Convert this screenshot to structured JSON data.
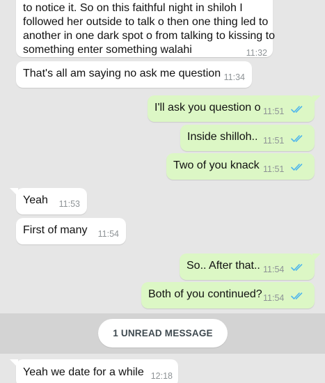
{
  "chat": {
    "messages": [
      {
        "direction": "in",
        "lines": [
          "to notice it. So on this faithful night in shiloh I",
          "followed her outside to talk o then one thing led to",
          "another in one dark spot o from talking to kissing to",
          "something enter something walahi"
        ],
        "time": "11:32"
      },
      {
        "direction": "in",
        "text": "That's all am saying no ask me question",
        "time": "11:34"
      },
      {
        "direction": "out",
        "text": "I'll ask you question o",
        "time": "11:51",
        "status": "read"
      },
      {
        "direction": "out",
        "text": "Inside shilloh..",
        "time": "11:51",
        "status": "read"
      },
      {
        "direction": "out",
        "text": "Two of you knack",
        "time": "11:51",
        "status": "read"
      },
      {
        "direction": "in",
        "text": "Yeah",
        "time": "11:53"
      },
      {
        "direction": "in",
        "text": "First of many",
        "time": "11:54"
      },
      {
        "direction": "out",
        "text": "So.. After that..",
        "time": "11:54",
        "status": "read"
      },
      {
        "direction": "out",
        "text": "Both of you continued?",
        "time": "11:54",
        "status": "read"
      },
      {
        "direction": "in",
        "text": "Yeah we date for a while",
        "time": "12:18"
      }
    ],
    "unread_divider": "1 UNREAD MESSAGE"
  },
  "colors": {
    "background": "#e6e6e6",
    "incoming_bubble": "#ffffff",
    "outgoing_bubble": "#dcf7c5",
    "read_ticks": "#4fb6ec",
    "timestamp": "#8e9396",
    "divider_band": "#d3d3d3"
  },
  "icons": {
    "read_receipt": "double-check-icon"
  }
}
